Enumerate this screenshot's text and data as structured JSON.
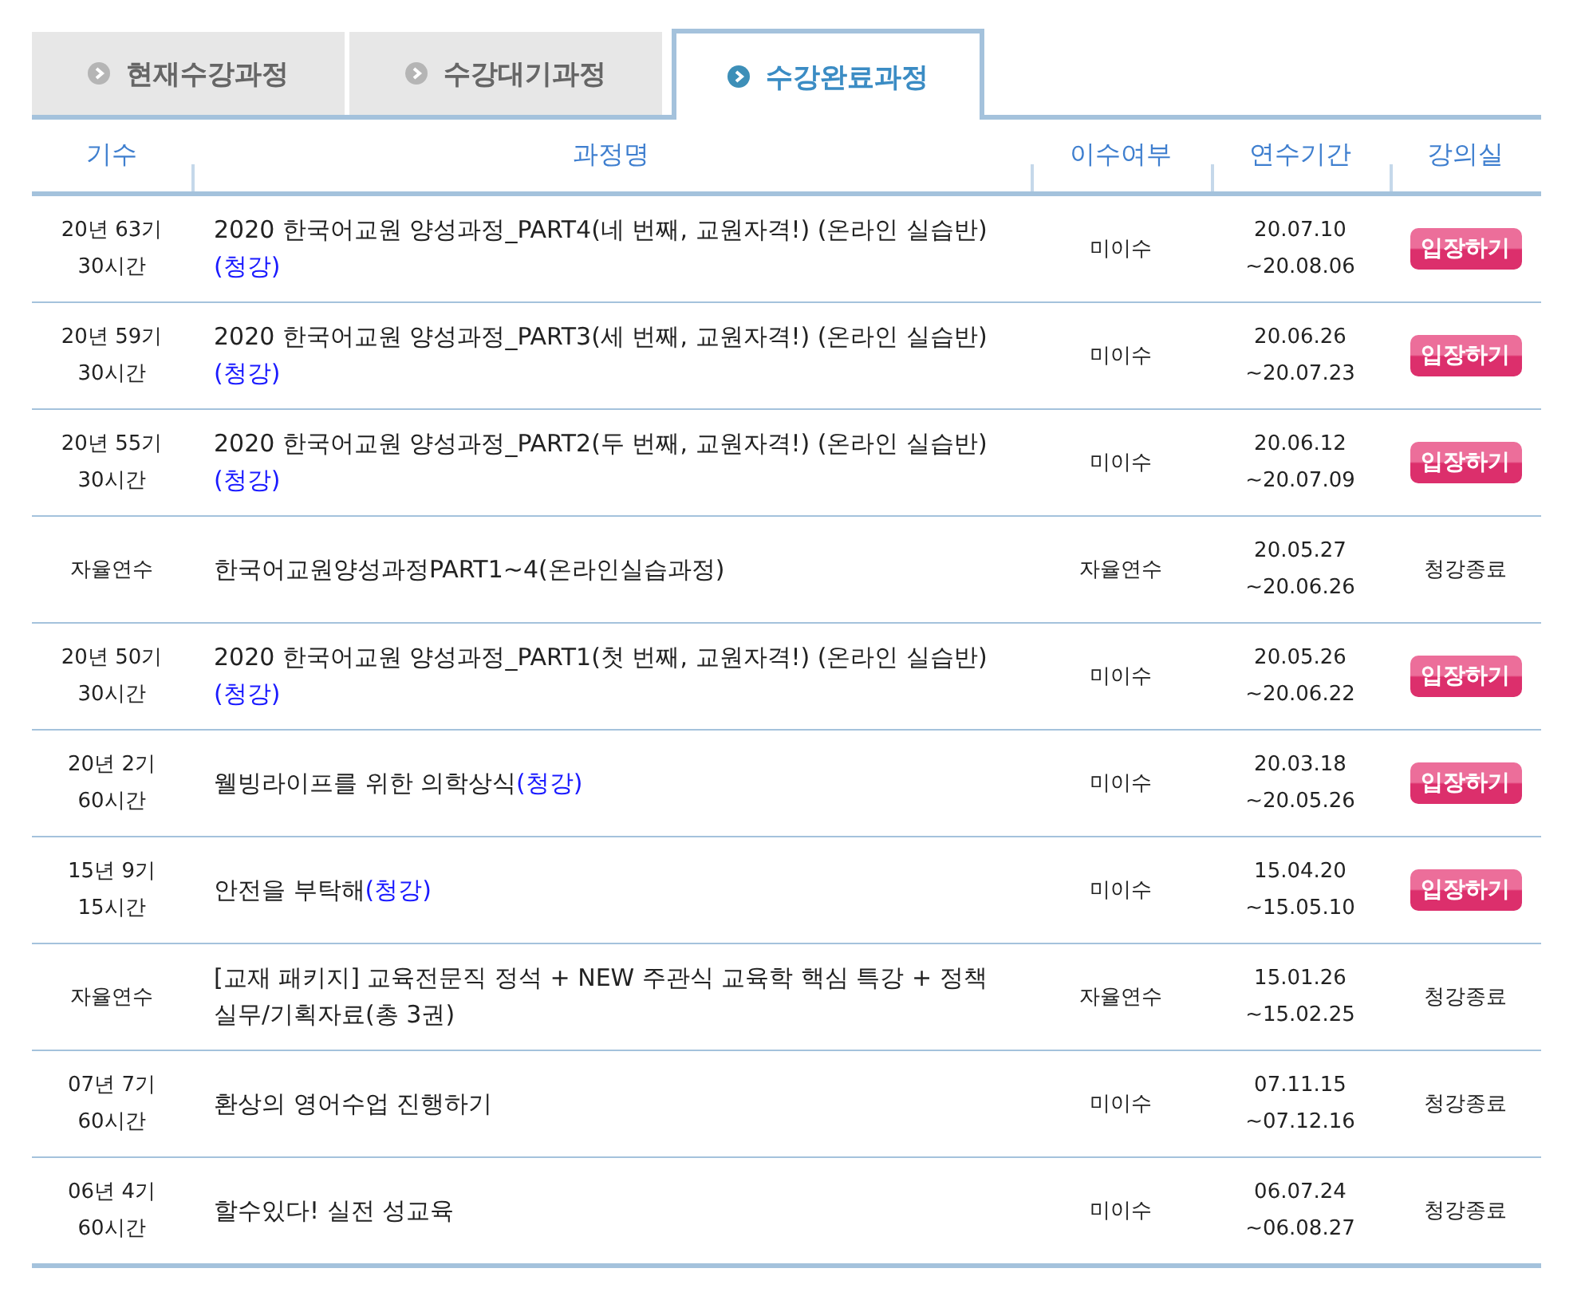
{
  "tabs": [
    {
      "label": "현재수강과정",
      "selected": false
    },
    {
      "label": "수강대기과정",
      "selected": false
    },
    {
      "label": "수강완료과정",
      "selected": true
    }
  ],
  "table": {
    "columns": [
      "기수",
      "과정명",
      "이수여부",
      "연수기간",
      "강의실"
    ],
    "rows": [
      {
        "term": [
          "20년 63기",
          "30시간"
        ],
        "title": [
          {
            "kind": "text",
            "text": "2020 한국어교원 양성과정_PART4(네 번째, 교원자격!) (온라인 실습반)"
          },
          {
            "kind": "link",
            "text": "(청강)"
          }
        ],
        "status": "미이수",
        "period": [
          "20.07.10",
          "~20.08.06"
        ],
        "room": {
          "kind": "button",
          "label": "입장하기"
        }
      },
      {
        "term": [
          "20년 59기",
          "30시간"
        ],
        "title": [
          {
            "kind": "text",
            "text": "2020 한국어교원 양성과정_PART3(세 번째, 교원자격!) (온라인 실습반)"
          },
          {
            "kind": "link",
            "text": "(청강)"
          }
        ],
        "status": "미이수",
        "period": [
          "20.06.26",
          "~20.07.23"
        ],
        "room": {
          "kind": "button",
          "label": "입장하기"
        }
      },
      {
        "term": [
          "20년 55기",
          "30시간"
        ],
        "title": [
          {
            "kind": "text",
            "text": "2020 한국어교원 양성과정_PART2(두 번째, 교원자격!) (온라인 실습반)"
          },
          {
            "kind": "link",
            "text": "(청강)"
          }
        ],
        "status": "미이수",
        "period": [
          "20.06.12",
          "~20.07.09"
        ],
        "room": {
          "kind": "button",
          "label": "입장하기"
        }
      },
      {
        "term": [
          "자율연수"
        ],
        "title": [
          {
            "kind": "text",
            "text": "한국어교원양성과정PART1~4(온라인실습과정)"
          }
        ],
        "status": "자율연수",
        "period": [
          "20.05.27",
          "~20.06.26"
        ],
        "room": {
          "kind": "text",
          "label": "청강종료"
        }
      },
      {
        "term": [
          "20년 50기",
          "30시간"
        ],
        "title": [
          {
            "kind": "text",
            "text": "2020 한국어교원 양성과정_PART1(첫 번째, 교원자격!) (온라인 실습반)"
          },
          {
            "kind": "link",
            "text": "(청강)"
          }
        ],
        "status": "미이수",
        "period": [
          "20.05.26",
          "~20.06.22"
        ],
        "room": {
          "kind": "button",
          "label": "입장하기"
        }
      },
      {
        "term": [
          "20년 2기",
          "60시간"
        ],
        "title": [
          {
            "kind": "text",
            "text": "웰빙라이프를 위한 의학상식"
          },
          {
            "kind": "link",
            "text": "(청강)"
          }
        ],
        "status": "미이수",
        "period": [
          "20.03.18",
          "~20.05.26"
        ],
        "room": {
          "kind": "button",
          "label": "입장하기"
        }
      },
      {
        "term": [
          "15년 9기",
          "15시간"
        ],
        "title": [
          {
            "kind": "text",
            "text": "안전을 부탁해"
          },
          {
            "kind": "link",
            "text": "(청강)"
          }
        ],
        "status": "미이수",
        "period": [
          "15.04.20",
          "~15.05.10"
        ],
        "room": {
          "kind": "button",
          "label": "입장하기"
        }
      },
      {
        "term": [
          "자율연수"
        ],
        "title": [
          {
            "kind": "text",
            "text": "[교재 패키지] 교육전문직 정석 + NEW 주관식 교육학 핵심 특강 + 정책실무/기획자료(총 3권)"
          }
        ],
        "status": "자율연수",
        "period": [
          "15.01.26",
          "~15.02.25"
        ],
        "room": {
          "kind": "text",
          "label": "청강종료"
        }
      },
      {
        "term": [
          "07년 7기",
          "60시간"
        ],
        "title": [
          {
            "kind": "text",
            "text": "환상의 영어수업 진행하기"
          }
        ],
        "status": "미이수",
        "period": [
          "07.11.15",
          "~07.12.16"
        ],
        "room": {
          "kind": "text",
          "label": "청강종료"
        }
      },
      {
        "term": [
          "06년 4기",
          "60시간"
        ],
        "title": [
          {
            "kind": "text",
            "text": "할수있다! 실전 성교육"
          }
        ],
        "status": "미이수",
        "period": [
          "06.07.24",
          "~06.08.27"
        ],
        "room": {
          "kind": "text",
          "label": "청강종료"
        }
      }
    ]
  }
}
